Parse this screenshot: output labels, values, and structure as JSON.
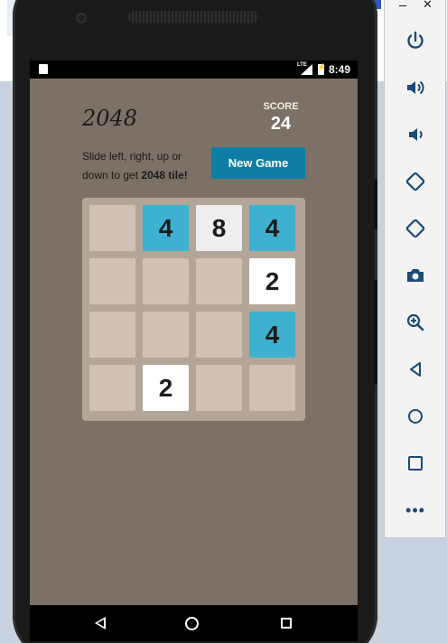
{
  "status_bar": {
    "network": "LTE",
    "time": "8:49"
  },
  "game": {
    "title": "2048",
    "score_label": "SCORE",
    "score_value": "24",
    "intro_prefix": "Slide left, right, up or down to get ",
    "intro_bold": "2048 tile!",
    "new_game_label": "New Game"
  },
  "board": {
    "rows": [
      [
        "",
        "4",
        "8",
        "4"
      ],
      [
        "",
        "",
        "",
        "2"
      ],
      [
        "",
        "",
        "",
        "4"
      ],
      [
        "",
        "2",
        "",
        ""
      ]
    ],
    "colors": {
      "empty": "#d0c3b6",
      "2": "#ffffff",
      "4": "#3fb1d0",
      "8": "#eeeeee"
    }
  },
  "emulator_toolbar": {
    "buttons": [
      "power-icon",
      "volume-up-icon",
      "volume-down-icon",
      "rotate-left-icon",
      "rotate-right-icon",
      "camera-icon",
      "zoom-in-icon",
      "back-icon",
      "home-icon",
      "overview-icon",
      "more-icon"
    ],
    "more_label": "•••"
  },
  "colors": {
    "screen_bg": "#7b7167",
    "new_game_bg": "#0e7ea7",
    "board_bg": "#b3a699"
  }
}
